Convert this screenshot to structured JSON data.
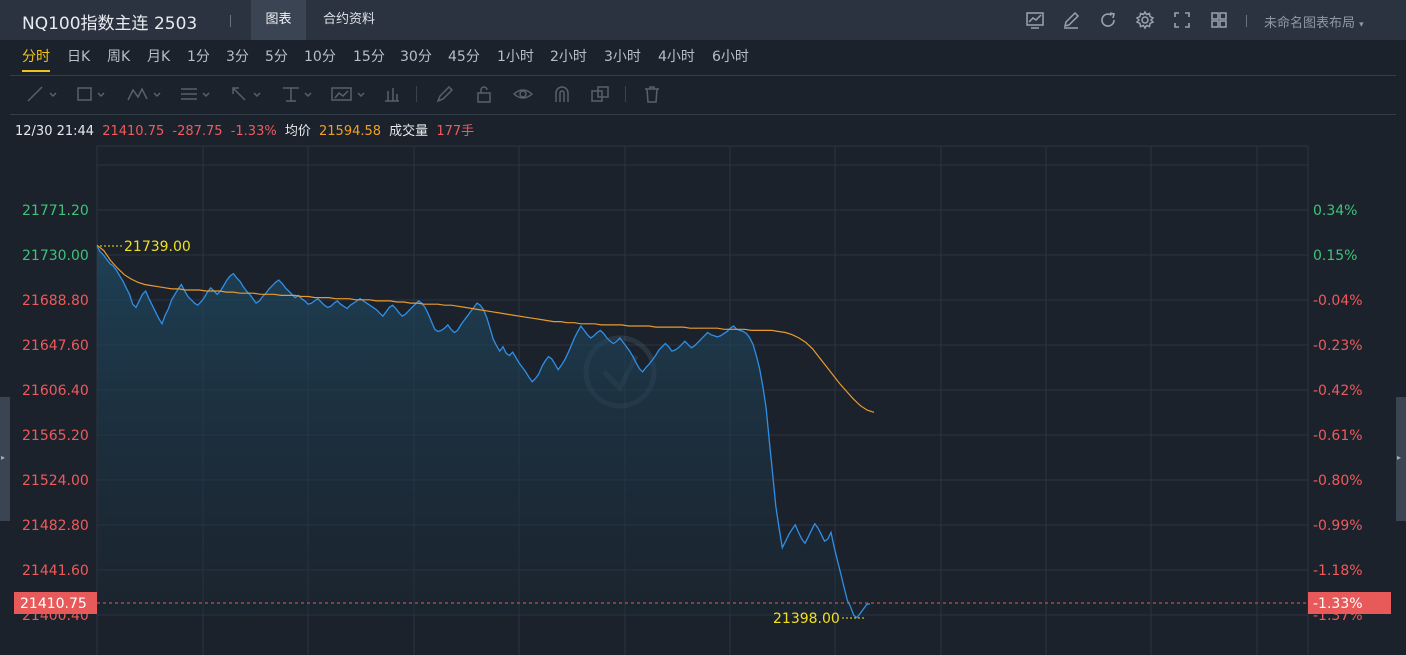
{
  "header": {
    "title": "NQ100指数主连 2503",
    "tabs": [
      "图表",
      "合约资料"
    ],
    "layout_label": "未命名图表布局"
  },
  "periods": [
    "分时",
    "日K",
    "周K",
    "月K",
    "1分",
    "3分",
    "5分",
    "10分",
    "15分",
    "30分",
    "45分",
    "1小时",
    "2小时",
    "3小时",
    "4小时",
    "6小时"
  ],
  "active_period": "分时",
  "info": {
    "time": "12/30 21:44",
    "price": "21410.75",
    "change": "-287.75",
    "change_pct": "-1.33%",
    "avg_label": "均价",
    "avg_value": "21594.58",
    "volume_label": "成交量",
    "volume_value": "177手"
  },
  "chart_data": {
    "type": "line",
    "title": "",
    "xlabel": "",
    "ylabel": "",
    "y_ticks": [
      "21771.20",
      "21730.00",
      "21688.80",
      "21647.60",
      "21606.40",
      "21565.20",
      "21524.00",
      "21482.80",
      "21441.60",
      "21400.40"
    ],
    "pct_ticks": [
      "0.34%",
      "0.15%",
      "-0.04%",
      "-0.23%",
      "-0.42%",
      "-0.61%",
      "-0.80%",
      "-0.99%",
      "-1.18%",
      "-1.37%"
    ],
    "ylim": [
      21381,
      21791
    ],
    "current_price_label": "21410.75",
    "current_pct_label": "-1.33%",
    "high_label": "21739.00",
    "low_label": "21398.00",
    "series": [
      {
        "values": [
          21738,
          21733,
          21730,
          21726,
          21722,
          21720,
          21716,
          21711,
          21706,
          21700,
          21694,
          21685,
          21682,
          21688,
          21694,
          21697,
          21690,
          21684,
          21678,
          21672,
          21667,
          21675,
          21681,
          21689,
          21694,
          21699,
          21703,
          21697,
          21692,
          21689,
          21686,
          21684,
          21687,
          21691,
          21696,
          21700,
          21697,
          21694,
          21697,
          21702,
          21707,
          21711,
          21713,
          21709,
          21706,
          21701,
          21697,
          21694,
          21690,
          21686,
          21688,
          21692,
          21695,
          21699,
          21702,
          21705,
          21707,
          21704,
          21700,
          21697,
          21694,
          21691,
          21693,
          21690,
          21688,
          21685,
          21686,
          21688,
          21690,
          21687,
          21684,
          21682,
          21683,
          21686,
          21688,
          21685,
          21683,
          21681,
          21684,
          21686,
          21688,
          21690,
          21688,
          21686,
          21684,
          21682,
          21680,
          21677,
          21674,
          21678,
          21682,
          21684,
          21681,
          21677,
          21674,
          21676,
          21679,
          21682,
          21685,
          21688,
          21686,
          21682,
          21676,
          21669,
          21662,
          21660,
          21661,
          21663,
          21666,
          21662,
          21659,
          21661,
          21666,
          21670,
          21674,
          21678,
          21682,
          21686,
          21684,
          21680,
          21673,
          21663,
          21653,
          21647,
          21642,
          21646,
          21640,
          21638,
          21641,
          21636,
          21631,
          21627,
          21623,
          21618,
          21614,
          21617,
          21621,
          21628,
          21633,
          21637,
          21635,
          21630,
          21625,
          21629,
          21634,
          21640,
          21647,
          21654,
          21660,
          21665,
          21661,
          21657,
          21654,
          21656,
          21659,
          21661,
          21658,
          21654,
          21651,
          21649,
          21651,
          21654,
          21650,
          21646,
          21642,
          21637,
          21631,
          21626,
          21623,
          21627,
          21630,
          21634,
          21638,
          21643,
          21646,
          21649,
          21646,
          21642,
          21643,
          21645,
          21648,
          21651,
          21648,
          21645,
          21647,
          21650,
          21653,
          21656,
          21659,
          21657,
          21656,
          21655,
          21656,
          21658,
          21660,
          21663,
          21665,
          21662,
          21661,
          21660,
          21658,
          21654,
          21648,
          21638,
          21626,
          21610,
          21590,
          21560,
          21530,
          21500,
          21480,
          21462,
          21468,
          21474,
          21479,
          21483,
          21476,
          21470,
          21466,
          21472,
          21478,
          21484,
          21480,
          21474,
          21468,
          21470,
          21476,
          21462,
          21450,
          21438,
          21426,
          21414,
          21408,
          21400,
          21398,
          21402,
          21406,
          21410,
          21410.75
        ]
      },
      {
        "name": "均价",
        "values": [
          21739,
          21734,
          21725,
          21718,
          21712,
          21708,
          21705,
          21703,
          21702,
          21701,
          21700,
          21699,
          21699,
          21698,
          21698,
          21698,
          21697,
          21697,
          21697,
          21696,
          21696,
          21695,
          21695,
          21695,
          21694,
          21694,
          21694,
          21693,
          21693,
          21693,
          21692,
          21692,
          21691,
          21691,
          21691,
          21690,
          21690,
          21690,
          21689,
          21689,
          21689,
          21688,
          21688,
          21688,
          21687,
          21687,
          21686,
          21686,
          21685,
          21685,
          21685,
          21684,
          21684,
          21683,
          21682,
          21681,
          21680,
          21679,
          21678,
          21677,
          21676,
          21675,
          21674,
          21673,
          21672,
          21671,
          21670,
          21669,
          21669,
          21668,
          21668,
          21667,
          21667,
          21667,
          21666,
          21666,
          21666,
          21666,
          21665,
          21665,
          21665,
          21665,
          21664,
          21664,
          21664,
          21664,
          21664,
          21663,
          21663,
          21663,
          21663,
          21663,
          21662,
          21662,
          21662,
          21662,
          21661,
          21661,
          21661,
          21661,
          21660,
          21659,
          21657,
          21654,
          21650,
          21644,
          21636,
          21628,
          21620,
          21612,
          21605,
          21598,
          21592,
          21588,
          21586
        ]
      }
    ]
  }
}
